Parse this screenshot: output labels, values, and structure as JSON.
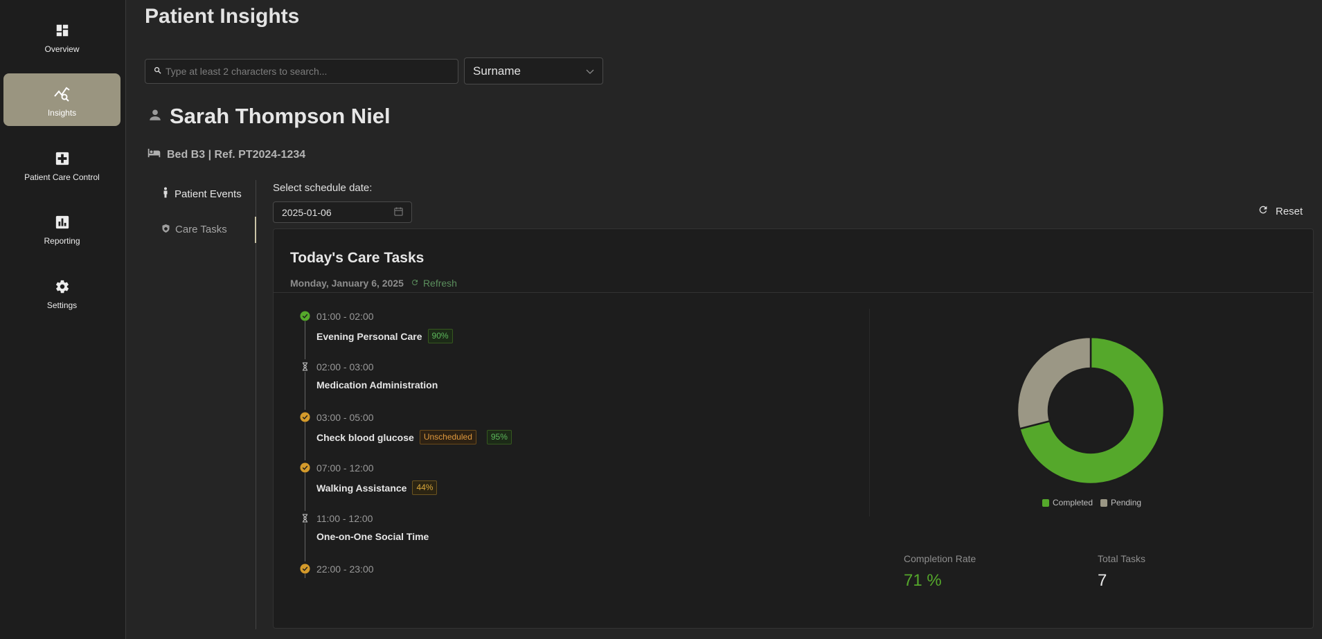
{
  "sidebar": {
    "items": [
      {
        "label": "Overview",
        "icon": "dashboard-icon"
      },
      {
        "label": "Insights",
        "icon": "insights-icon",
        "active": true
      },
      {
        "label": "Patient Care Control",
        "icon": "medical-cross-icon"
      },
      {
        "label": "Reporting",
        "icon": "bar-chart-icon"
      },
      {
        "label": "Settings",
        "icon": "gear-icon"
      }
    ]
  },
  "page": {
    "title": "Patient Insights"
  },
  "search": {
    "placeholder": "Type at least 2 characters to search...",
    "value": ""
  },
  "filter": {
    "selected": "Surname"
  },
  "patient": {
    "name": "Sarah Thompson Niel",
    "bed_info": "Bed B3 | Ref. PT2024-1234"
  },
  "subnav": {
    "items": [
      {
        "label": "Patient Events",
        "icon": "person-icon"
      },
      {
        "label": "Care Tasks",
        "icon": "shield-icon",
        "active": true
      }
    ]
  },
  "schedule": {
    "label": "Select schedule date:",
    "date": "2025-01-06"
  },
  "reset": {
    "label": "Reset"
  },
  "care_tasks": {
    "title": "Today's Care Tasks",
    "date_text": "Monday, January 6, 2025",
    "refresh_label": "Refresh",
    "tasks": [
      {
        "time": "01:00 - 02:00",
        "title": "Evening Personal Care",
        "status": "completed",
        "tags": [
          {
            "text": "90%",
            "style": "green"
          }
        ]
      },
      {
        "time": "02:00 - 03:00",
        "title": "Medication Administration",
        "status": "pending",
        "tags": []
      },
      {
        "time": "03:00 - 05:00",
        "title": "Check blood glucose",
        "status": "partial",
        "tags": [
          {
            "text": "Unscheduled",
            "style": "orange"
          },
          {
            "text": "95%",
            "style": "green"
          }
        ]
      },
      {
        "time": "07:00 - 12:00",
        "title": "Walking Assistance",
        "status": "partial",
        "tags": [
          {
            "text": "44%",
            "style": "yellow"
          }
        ]
      },
      {
        "time": "11:00 - 12:00",
        "title": "One-on-One Social Time",
        "status": "pending",
        "tags": []
      },
      {
        "time": "22:00 - 23:00",
        "title": "",
        "status": "partial",
        "tags": []
      }
    ]
  },
  "chart_data": {
    "type": "pie",
    "categories": [
      "Completed",
      "Pending"
    ],
    "values": [
      71,
      29
    ],
    "colors": [
      "#55a82b",
      "#9b9785"
    ],
    "legend_position": "bottom"
  },
  "stats": {
    "completion_rate_label": "Completion Rate",
    "completion_rate_value": "71 %",
    "total_tasks_label": "Total Tasks",
    "total_tasks_value": "7"
  },
  "colors": {
    "accent": "#9a9580",
    "success": "#55a82b",
    "warning": "#d9a73b",
    "pending": "#9b9785"
  }
}
